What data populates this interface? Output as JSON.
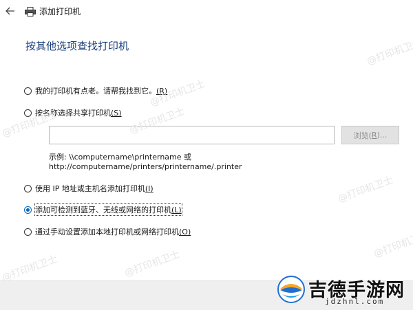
{
  "window": {
    "title": "添加打印机"
  },
  "heading": "按其他选项查找打印机",
  "options": [
    {
      "label": "我的打印机有点老。请帮我找到它。",
      "accel": "(R)",
      "checked": false
    },
    {
      "label": "按名称选择共享打印机",
      "accel": "(S)",
      "checked": false
    },
    {
      "label": "使用 IP 地址或主机名添加打印机",
      "accel": "(I)",
      "checked": false
    },
    {
      "label": "添加可检测到蓝牙、无线或网络的打印机",
      "accel": "(L)",
      "checked": true
    },
    {
      "label": "通过手动设置添加本地打印机或网络打印机",
      "accel": "(O)",
      "checked": false
    }
  ],
  "shared_printer": {
    "input_value": "",
    "browse_label": "浏览(",
    "browse_accel": "R",
    "browse_suffix": ")...",
    "example_line1": "示例: \\\\computername\\printername 或",
    "example_line2": "http://computername/printers/printername/.printer"
  },
  "watermarks": {
    "text": "@打印机卫士",
    "logo_text": "吉德手游网",
    "logo_sub": "jdzhnl.com"
  },
  "colors": {
    "heading": "#1b3f7e",
    "accent": "#0067c0",
    "footer_bg": "#efefef"
  }
}
